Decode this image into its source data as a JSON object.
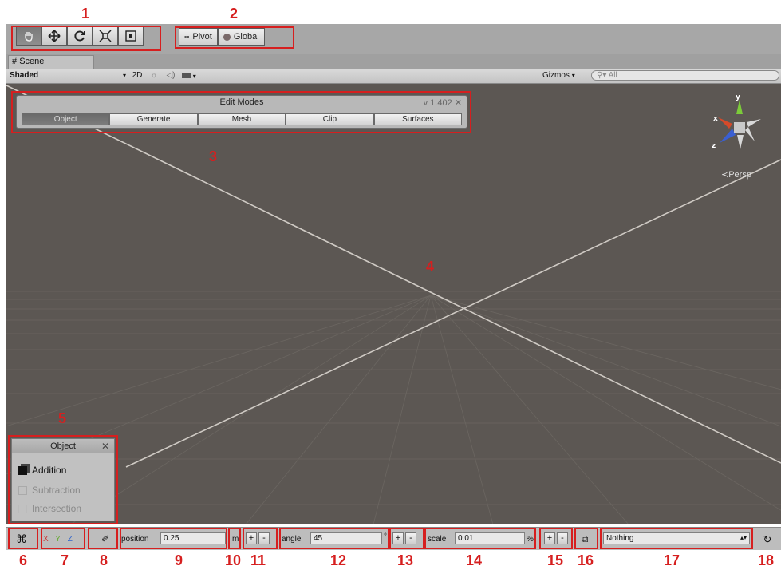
{
  "annotations": [
    "1",
    "2",
    "3",
    "4",
    "5",
    "6",
    "7",
    "8",
    "9",
    "10",
    "11",
    "12",
    "13",
    "14",
    "15",
    "16",
    "17",
    "18"
  ],
  "toolbar": {
    "tools": [
      "hand-icon",
      "move-icon",
      "rotate-icon",
      "scale-icon",
      "rect-icon"
    ],
    "pivot_label": "Pivot",
    "global_label": "Global"
  },
  "tab": {
    "scene_label": "Scene"
  },
  "scene_toolbar": {
    "shading": "Shaded",
    "mode_2d": "2D",
    "gizmos": "Gizmos",
    "search_placeholder": "All"
  },
  "edit_modes": {
    "title": "Edit Modes",
    "version": "v 1.402",
    "tabs": [
      "Object",
      "Generate",
      "Mesh",
      "Clip",
      "Surfaces"
    ],
    "active_tab": "Object"
  },
  "gizmo": {
    "persp_label": "Persp",
    "axis_x": "x",
    "axis_y": "y",
    "axis_z": "z"
  },
  "object_panel": {
    "title": "Object",
    "options": [
      "Addition",
      "Subtraction",
      "Intersection"
    ]
  },
  "bottom_bar": {
    "xyz": [
      "X",
      "Y",
      "Z"
    ],
    "position_label": "position",
    "position_value": "0.25",
    "position_unit": "m",
    "angle_label": "angle",
    "angle_value": "45",
    "angle_unit": "°",
    "scale_label": "scale",
    "scale_value": "0.01",
    "scale_unit": "%",
    "plus": "+",
    "minus": "-",
    "layer_value": "Nothing"
  },
  "colors": {
    "annotation": "#d61f1f",
    "viewport": "#5c5753"
  }
}
